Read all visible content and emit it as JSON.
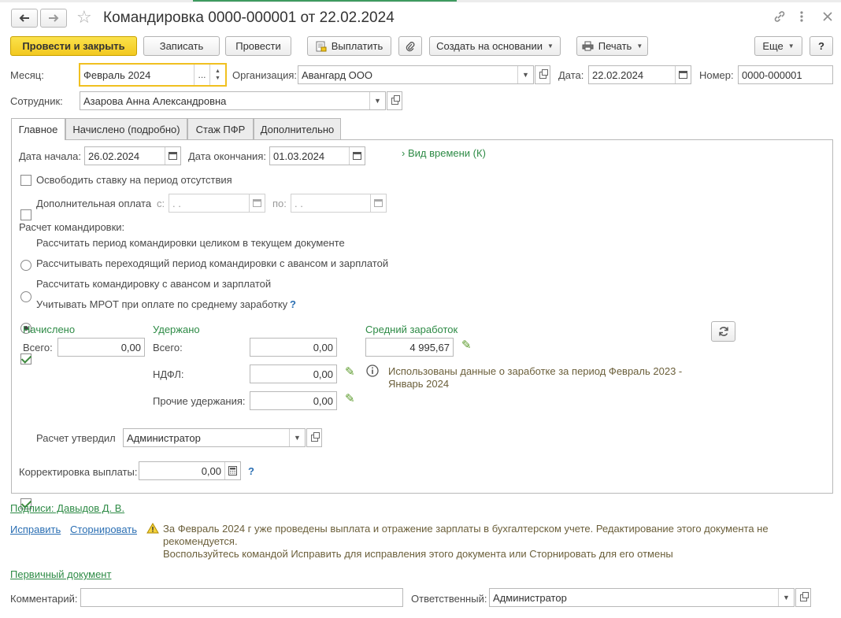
{
  "window": {
    "title": "Командировка 0000-000001 от 22.02.2024"
  },
  "toolbar": {
    "post_close": "Провести и закрыть",
    "save": "Записать",
    "post": "Провести",
    "pay": "Выплатить",
    "create_based": "Создать на основании",
    "print": "Печать",
    "more": "Еще",
    "help": "?"
  },
  "header": {
    "month_label": "Месяц:",
    "month_value": "Февраль 2024",
    "month_select": "...",
    "org_label": "Организация:",
    "org_value": "Авангард ООО",
    "date_label": "Дата:",
    "date_value": "22.02.2024",
    "number_label": "Номер:",
    "number_value": "0000-000001",
    "employee_label": "Сотрудник:",
    "employee_value": "Азарова Анна Александровна"
  },
  "tabs": [
    {
      "label": "Главное"
    },
    {
      "label": "Начислено (подробно)"
    },
    {
      "label": "Стаж ПФР"
    },
    {
      "label": "Дополнительно"
    }
  ],
  "main": {
    "start_label": "Дата начала:",
    "start_value": "26.02.2024",
    "end_label": "Дата окончания:",
    "end_value": "01.03.2024",
    "time_kind": "Вид времени (К)",
    "free_rate": "Освободить ставку на период отсутствия",
    "extra_pay": "Дополнительная оплата",
    "extra_from_label": "с:",
    "extra_from_value": "  .  .",
    "extra_to_label": "по:",
    "extra_to_value": "  .  .",
    "calc_label": "Расчет командировки:",
    "calc_options": [
      "Рассчитать период командировки целиком в текущем документе",
      "Рассчитывать переходящий период командировки с авансом и зарплатой",
      "Рассчитать командировку с авансом и зарплатой"
    ],
    "calc_selected_index": 2,
    "mrot": "Учитывать МРОТ при оплате по среднему заработку",
    "mrot_help": "?",
    "accrued_header": "Начислено",
    "accrued_total_label": "Всего:",
    "accrued_total_value": "0,00",
    "withheld_header": "Удержано",
    "withheld_total_label": "Всего:",
    "withheld_total_value": "0,00",
    "ndfl_label": "НДФЛ:",
    "ndfl_value": "0,00",
    "other_label": "Прочие удержания:",
    "other_value": "0,00",
    "avg_header": "Средний заработок",
    "avg_value": "4 995,67",
    "avg_info_line1": "Использованы данные о заработке за период Февраль 2023 -",
    "avg_info_line2": "Январь 2024",
    "approved_label": "Расчет утвердил",
    "approved_value": "Администратор",
    "correction_label": "Корректировка выплаты:",
    "correction_value": "0,00",
    "correction_help": "?"
  },
  "footer": {
    "signatures": "Подписи: Давыдов Д. В.",
    "fix": "Исправить",
    "reverse": "Сторнировать",
    "warning_line1": "За Февраль 2024 г уже проведены выплата и отражение зарплаты в бухгалтерском учете. Редактирование этого документа не",
    "warning_line2": "рекомендуется.",
    "warning_line3": "Воспользуйтесь командой Исправить для исправления этого документа или Сторнировать для его отмены",
    "primary_doc": "Первичный документ",
    "comment_label": "Комментарий:",
    "comment_value": "",
    "responsible_label": "Ответственный:",
    "responsible_value": "Администратор"
  },
  "colors": {
    "accent_yellow": "#f2c81f",
    "green_text": "#2e8b46",
    "link_blue": "#2b6fb3"
  }
}
